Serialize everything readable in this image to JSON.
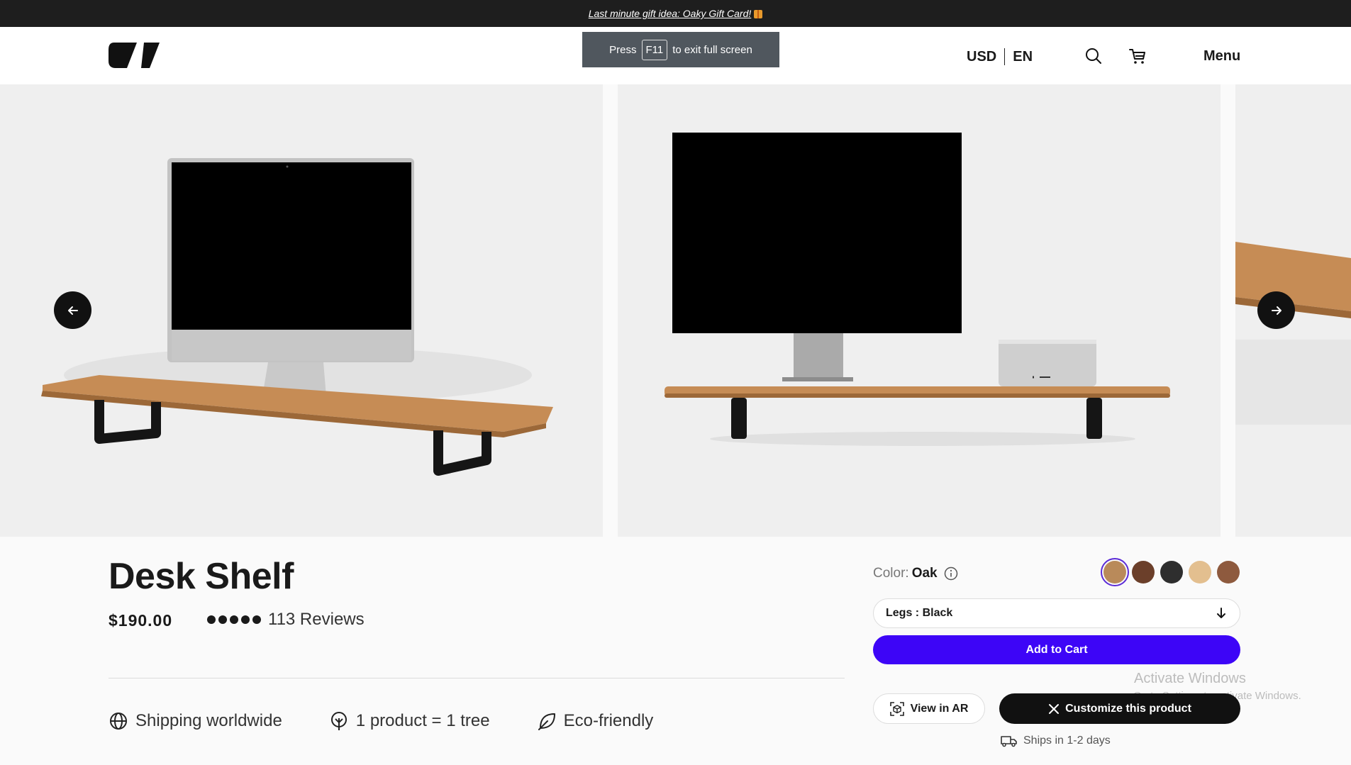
{
  "announcement": {
    "text": "Last minute gift idea: Oaky Gift Card!",
    "icon": "gift-icon"
  },
  "header": {
    "fullscreen_toast": {
      "press": "Press",
      "key": "F11",
      "suffix": "to exit full screen"
    },
    "currency": "USD",
    "language": "EN",
    "icons": [
      "search-icon",
      "cart-icon"
    ],
    "menu_label": "Menu"
  },
  "gallery": {
    "slides": [
      "desk-shelf-with-imac",
      "desk-shelf-with-monitor-and-mac-studio",
      "desk-shelf-closeup"
    ],
    "prev_icon": "arrow-left-icon",
    "next_icon": "arrow-right-icon"
  },
  "product": {
    "title": "Desk Shelf",
    "price": "$190.00",
    "rating_stars": 5,
    "reviews": "113 Reviews"
  },
  "features": [
    {
      "icon": "globe-icon",
      "label": "Shipping worldwide"
    },
    {
      "icon": "tree-icon",
      "label": "1 product = 1 tree"
    },
    {
      "icon": "leaf-icon",
      "label": "Eco-friendly"
    }
  ],
  "options": {
    "color_label": "Color:",
    "color_value": "Oak",
    "swatches": [
      {
        "name": "Oak",
        "color": "#b98a5a",
        "selected": true
      },
      {
        "name": "Walnut",
        "color": "#6b3f2a"
      },
      {
        "name": "Black",
        "color": "#2e2e2e"
      },
      {
        "name": "Maple",
        "color": "#e3bf8f"
      },
      {
        "name": "Cherry",
        "color": "#8e5a3e"
      }
    ],
    "legs_label": "Legs : Black"
  },
  "actions": {
    "add_to_cart": "Add to Cart",
    "view_ar": "View in AR",
    "customize": "Customize this product",
    "ships": "Ships in 1-2 days"
  },
  "watermark": {
    "title": "Activate Windows",
    "subtitle": "Go to Settings to activate Windows."
  },
  "colors": {
    "accent": "#3d05f7",
    "dark": "#111111",
    "topbar": "#1e1e1e"
  }
}
